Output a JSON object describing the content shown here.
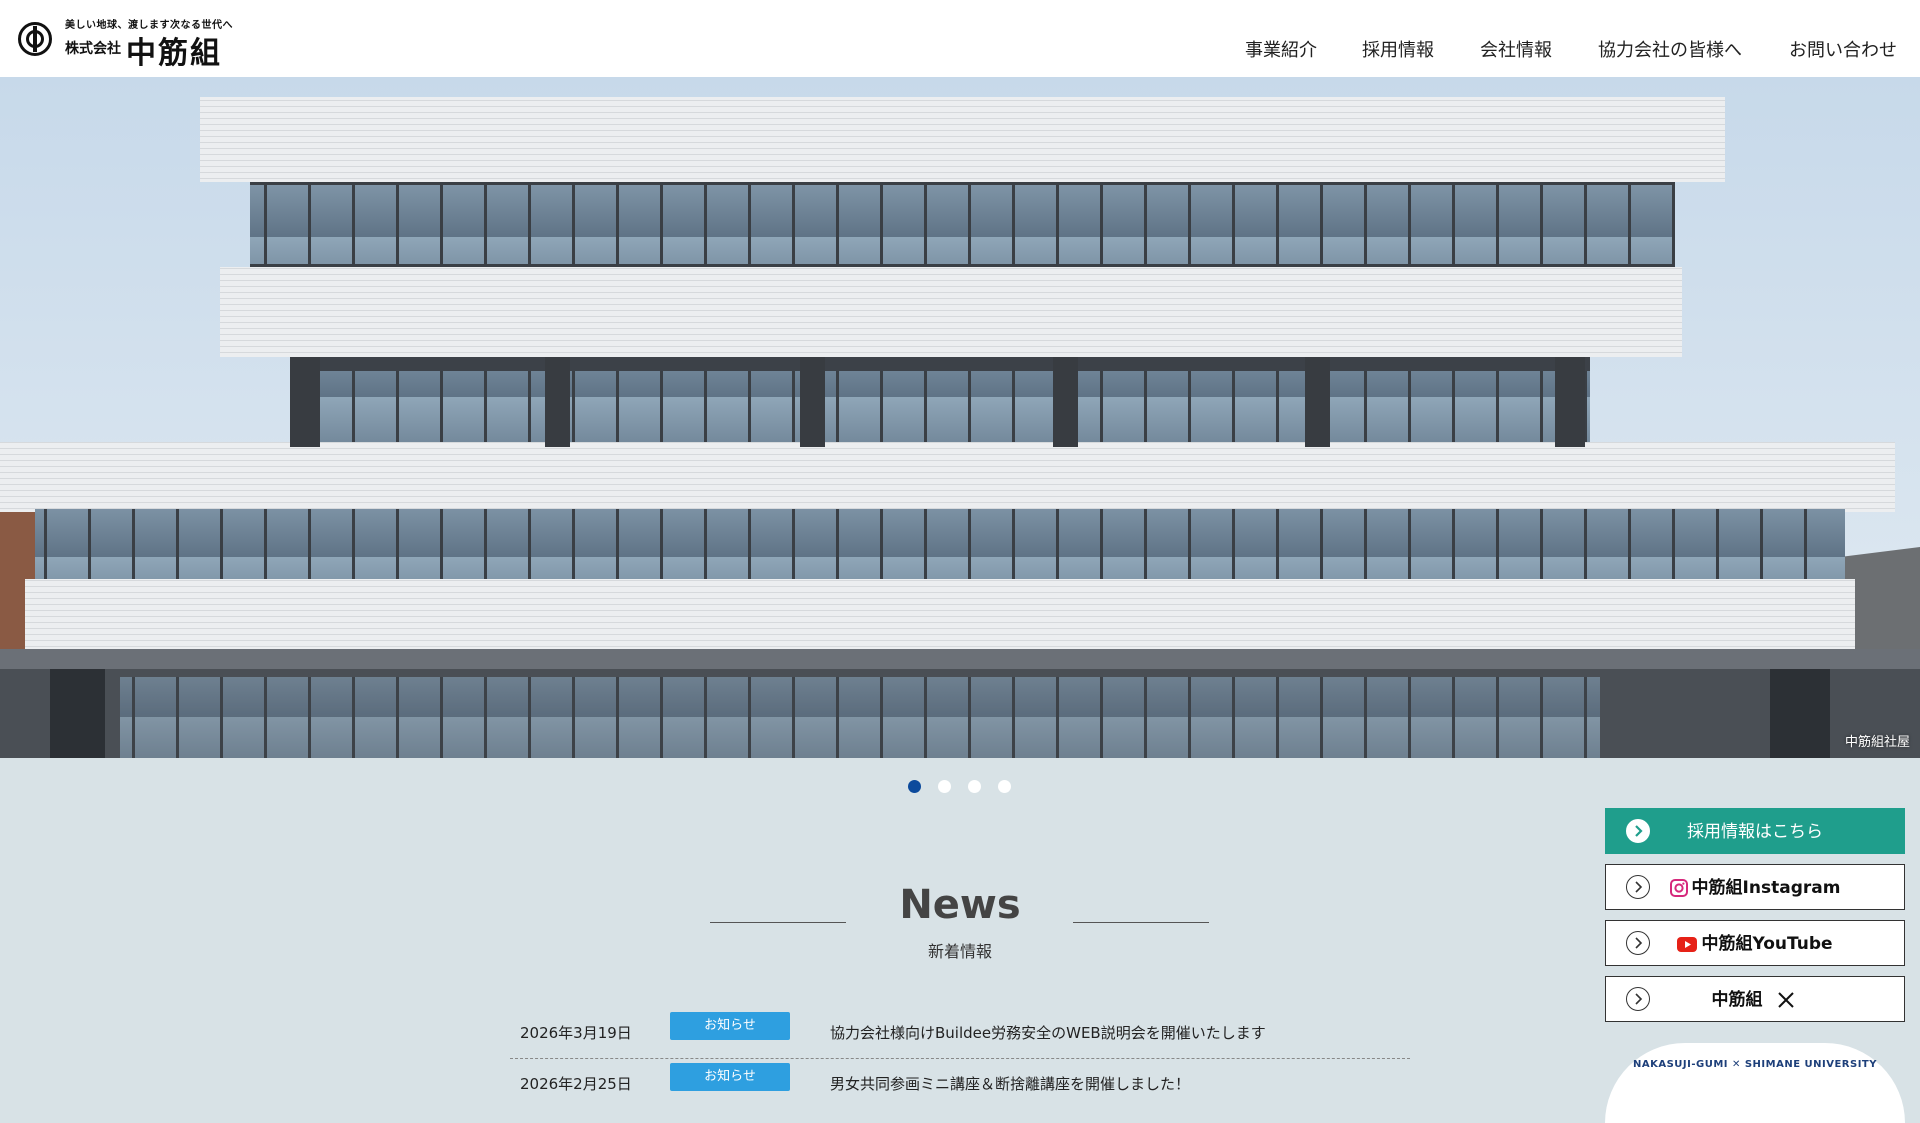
{
  "header": {
    "logo": {
      "tagline": "美しい地球、渡します次なる世代へ",
      "company_prefix": "株式会社",
      "company_name": "中筋組"
    },
    "nav": [
      {
        "label": "事業紹介"
      },
      {
        "label": "採用情報"
      },
      {
        "label": "会社情報"
      },
      {
        "label": "協力会社の皆様へ"
      },
      {
        "label": "お問い合わせ"
      }
    ]
  },
  "hero": {
    "caption": "中筋組社屋",
    "slides_total": 4,
    "active_slide": 1
  },
  "news": {
    "title": "News",
    "subtitle": "新着情報",
    "items": [
      {
        "date": "2026年3月19日",
        "category": "お知らせ",
        "text": "協力会社様向けBuildee労務安全のWEB説明会を開催いたします"
      },
      {
        "date": "2026年2月25日",
        "category": "お知らせ",
        "text": "男女共同参画ミニ講座＆断捨離講座を開催しました！"
      }
    ]
  },
  "side": {
    "recruit": "採用情報はこちら",
    "instagram": "中筋組Instagram",
    "youtube": "中筋組YouTube",
    "x": "中筋組",
    "univ": "NAKASUJI-GUMI ✕ SHIMANE UNIVERSITY"
  },
  "colors": {
    "accent_blue": "#0c4a9c",
    "category_badge": "#2e9fe0",
    "recruit_green": "#1f9e8c",
    "background": "#d8e2e6"
  },
  "icons": {
    "x_icon": "x-logo-icon",
    "instagram": "instagram-icon",
    "youtube": "youtube-icon",
    "arrow": "chevron-right-circle-icon"
  }
}
